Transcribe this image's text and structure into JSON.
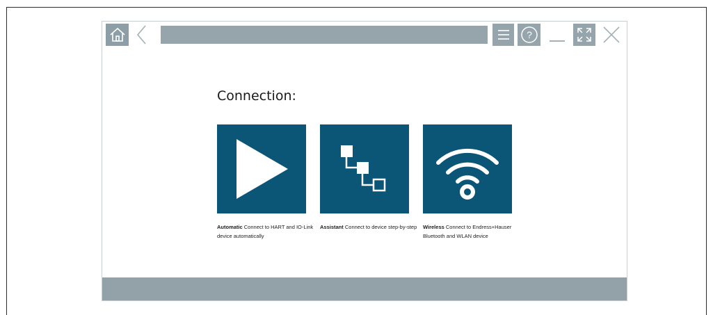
{
  "connection": {
    "heading": "Connection:",
    "options": [
      {
        "title": "Automatic",
        "description": "Connect to HART and IO-Link device automatically"
      },
      {
        "title": "Assistant",
        "description": "Connect to device step-by-step"
      },
      {
        "title": "Wireless",
        "description": "Connect to Endress+Hauser Bluetooth and WLAN device"
      }
    ]
  },
  "toolbar": {
    "icons": [
      "home-icon",
      "back-icon",
      "menu-icon",
      "help-icon",
      "minimize-icon",
      "maximize-icon",
      "close-icon"
    ],
    "help_glyph": "?"
  },
  "colors": {
    "tile": "#0b5577",
    "toolbar_gray": "#96a4ab",
    "statusbar": "#93a1a9"
  }
}
